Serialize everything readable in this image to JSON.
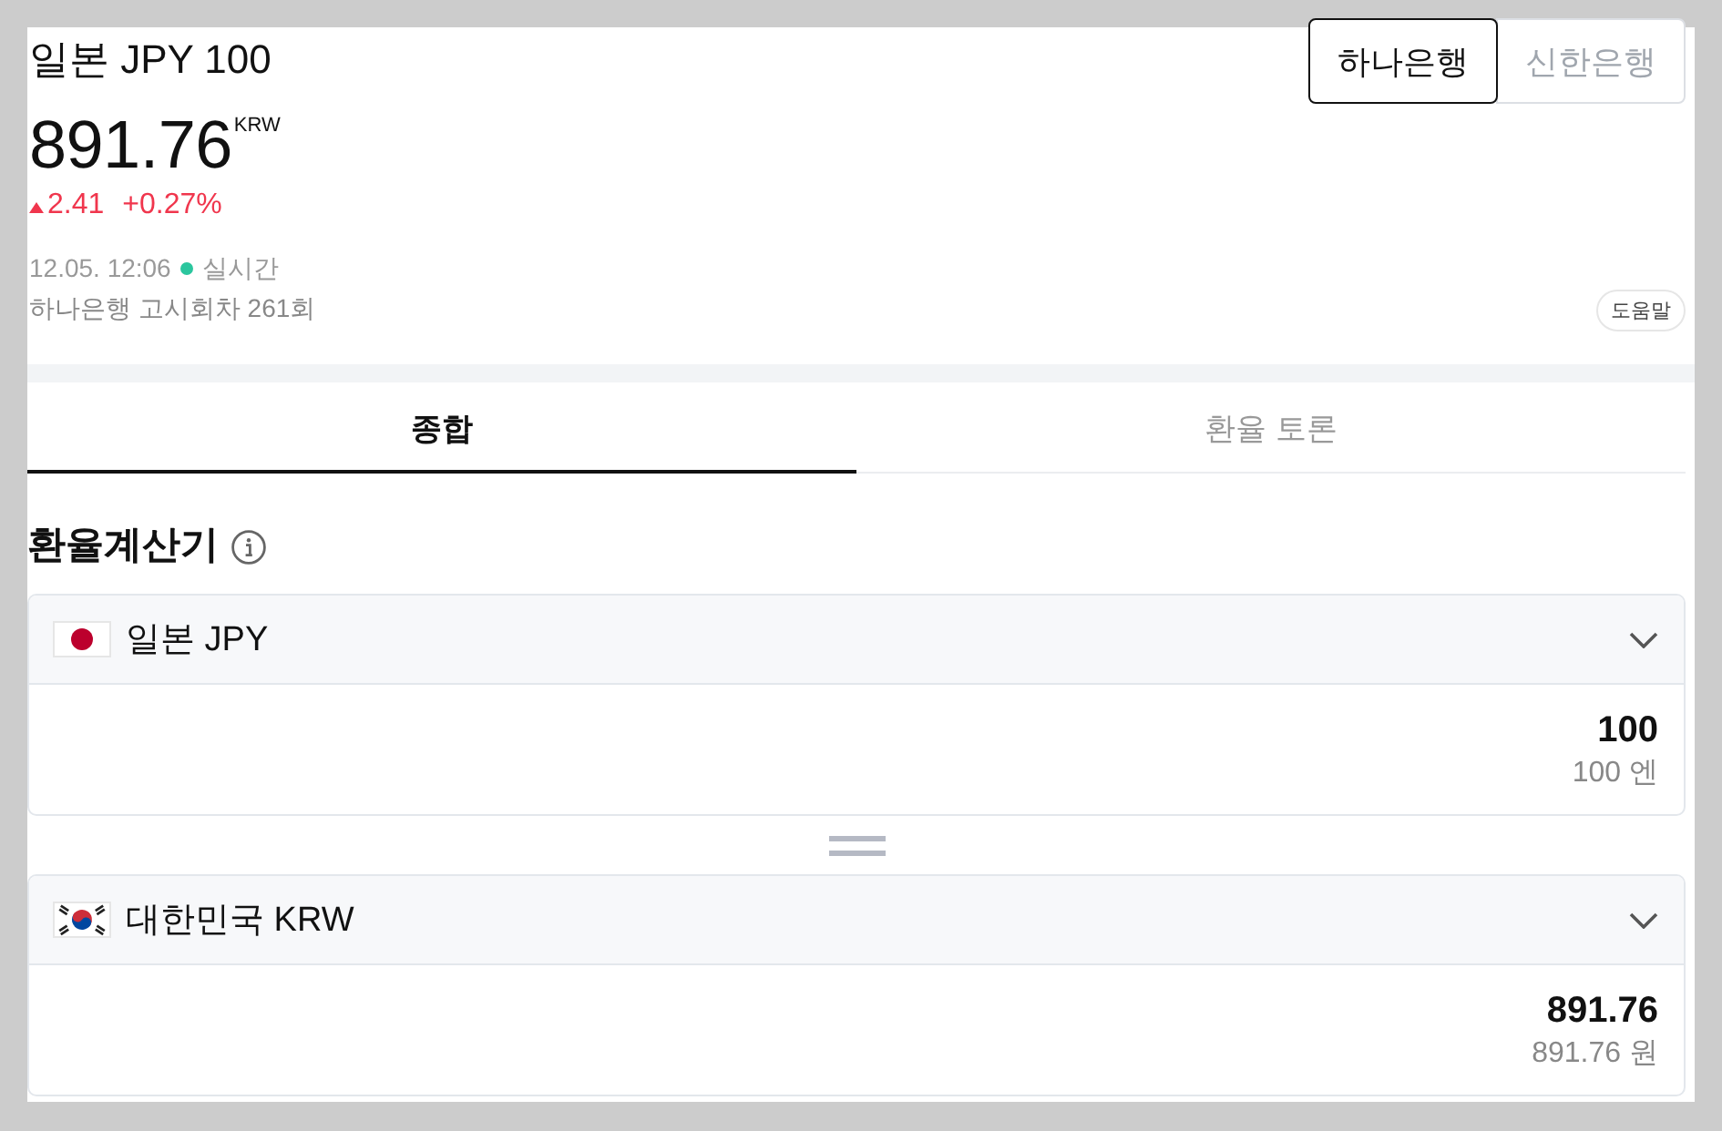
{
  "header": {
    "title": "일본 JPY 100",
    "price": "891.76",
    "unit": "KRW",
    "change": {
      "up": true,
      "amount": "2.41",
      "percent": "+0.27%"
    },
    "time": "12.05. 12:06",
    "live": true,
    "live_label": "실시간",
    "notice": "하나은행 고시회차 261회",
    "help": "도움말"
  },
  "banks": [
    {
      "label": "하나은행",
      "selected": true
    },
    {
      "label": "신한은행",
      "selected": false
    }
  ],
  "tabs": [
    {
      "label": "종합",
      "selected": true
    },
    {
      "label": "환율 토론",
      "selected": false
    }
  ],
  "calculator": {
    "title": "환율계산기",
    "currencies": [
      {
        "kind": "jp",
        "name": "일본 JPY",
        "amount": "100",
        "amount_text": "100 엔"
      },
      {
        "kind": "kr",
        "name": "대한민국 KRW",
        "amount": "891.76",
        "amount_text": "891.76 원"
      }
    ]
  }
}
